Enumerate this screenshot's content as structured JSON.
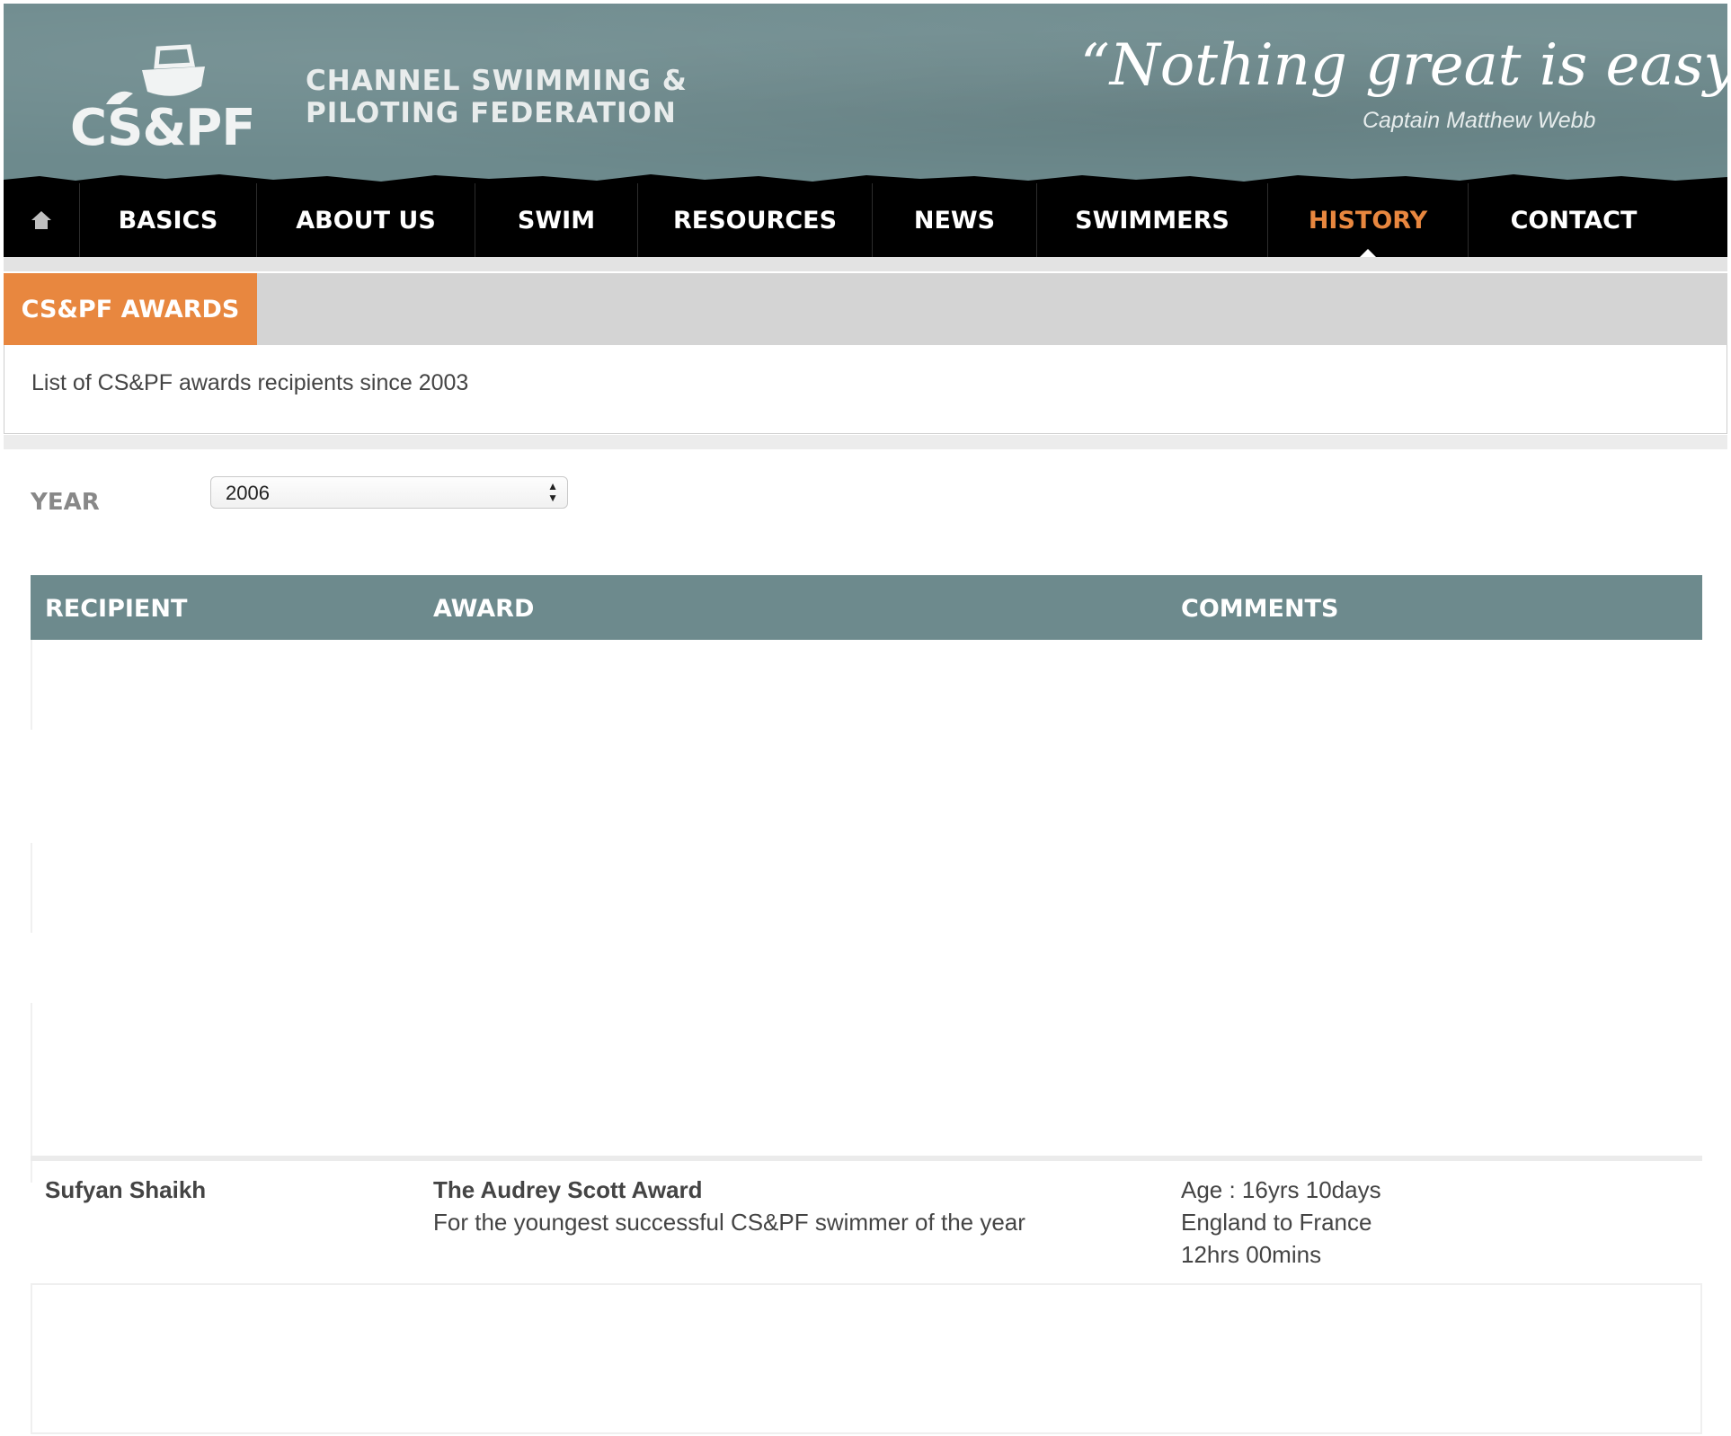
{
  "header": {
    "logo_text": "CS&PF",
    "org_name_line1": "CHANNEL SWIMMING &",
    "org_name_line2": "PILOTING FEDERATION",
    "quote": "“Nothing great is easy”",
    "quote_author": "Captain Matthew Webb",
    "background_color": "#6d8a8d"
  },
  "nav": {
    "home_icon": "home-icon",
    "items": [
      {
        "label": "BASICS"
      },
      {
        "label": "ABOUT US"
      },
      {
        "label": "SWIM"
      },
      {
        "label": "RESOURCES"
      },
      {
        "label": "NEWS"
      },
      {
        "label": "SWIMMERS"
      },
      {
        "label": "HISTORY",
        "active": true
      },
      {
        "label": "CONTACT"
      }
    ],
    "active_color": "#e8873f"
  },
  "panel": {
    "title": "CS&PF AWARDS",
    "description": "List of CS&PF awards recipients since 2003",
    "accent_color": "#e8873f"
  },
  "filter": {
    "label": "YEAR",
    "selected_year": "2006"
  },
  "table": {
    "headers": [
      "RECIPIENT",
      "AWARD",
      "COMMENTS"
    ],
    "rows": [
      {
        "recipient": "Sufyan Shaikh",
        "award_title": "The Audrey Scott Award",
        "award_description": "For the youngest successful CS&PF swimmer of the year",
        "comments": [
          "Age : 16yrs 10days",
          "England to France",
          "12hrs 00mins"
        ]
      }
    ]
  }
}
